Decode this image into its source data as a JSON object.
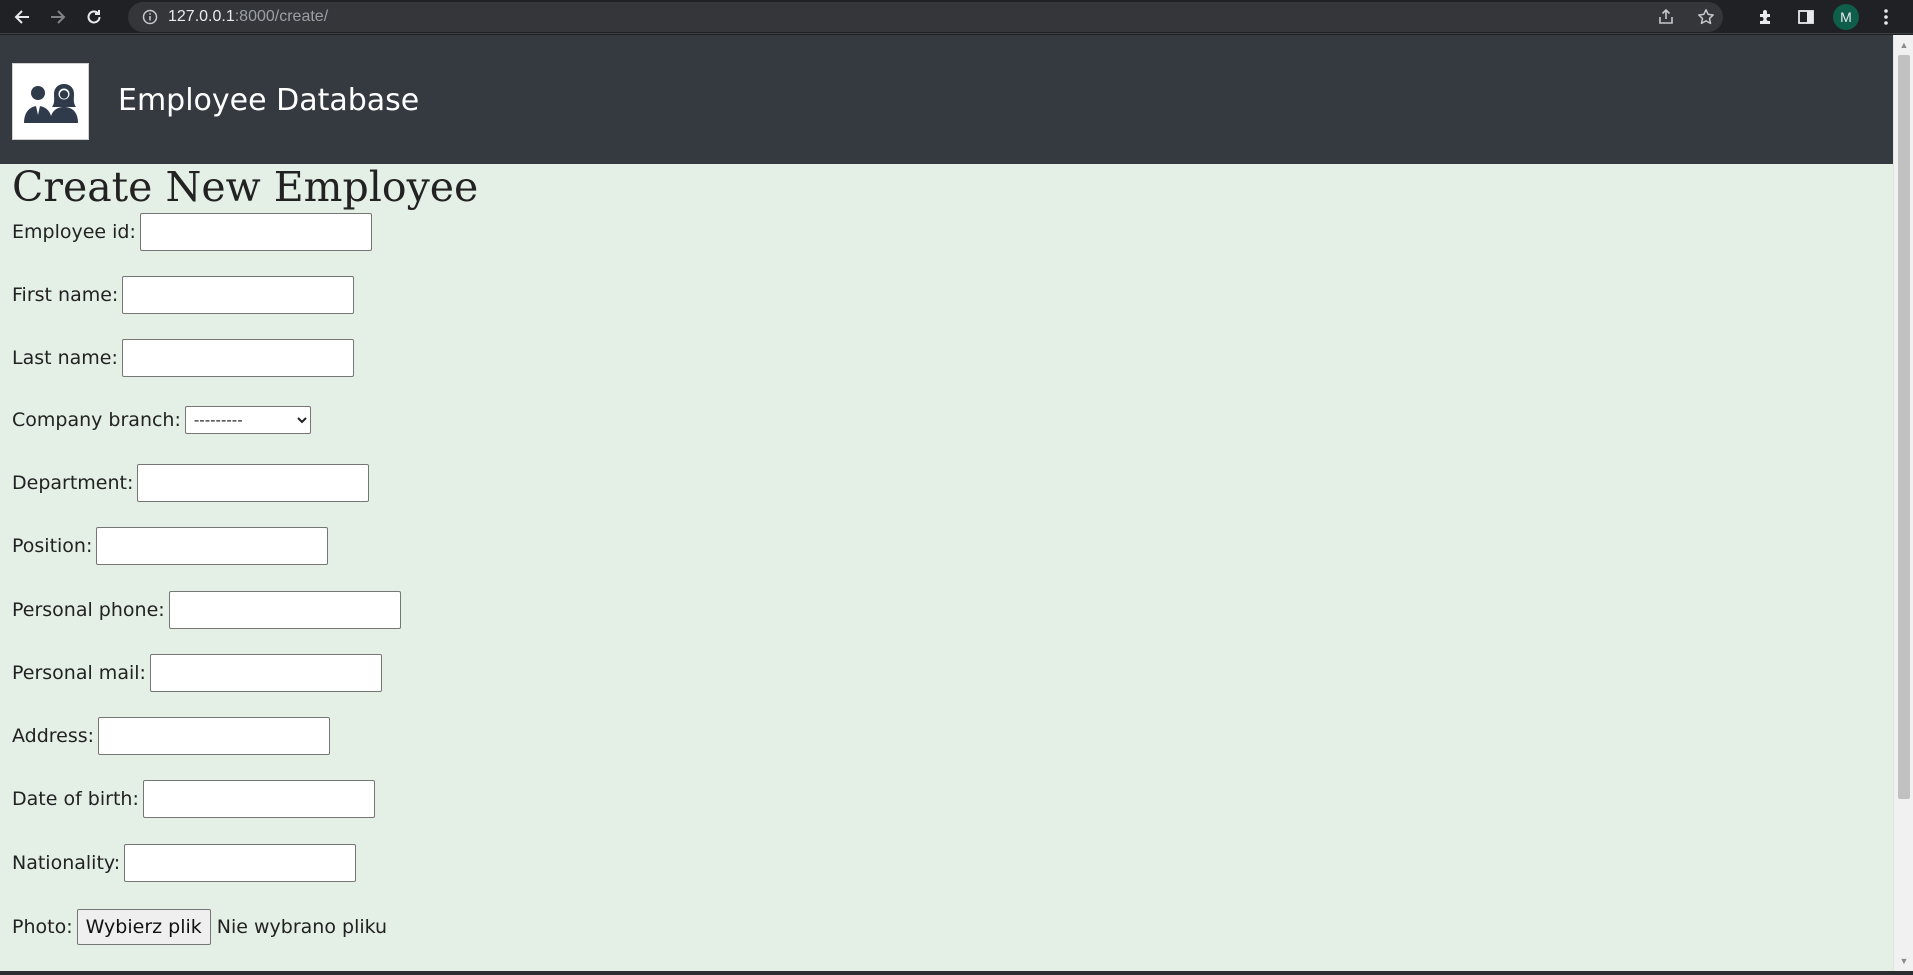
{
  "browser": {
    "url_host": "127.0.0.1",
    "url_rest": ":8000/create/",
    "profile_initial": "M"
  },
  "header": {
    "site_title": "Employee Database"
  },
  "form": {
    "title": "Create New Employee",
    "fields": {
      "employee_id": {
        "label": "Employee id:",
        "value": ""
      },
      "first_name": {
        "label": "First name:",
        "value": ""
      },
      "last_name": {
        "label": "Last name:",
        "value": ""
      },
      "company_branch": {
        "label": "Company branch:",
        "selected": "---------"
      },
      "department": {
        "label": "Department:",
        "value": ""
      },
      "position": {
        "label": "Position:",
        "value": ""
      },
      "personal_phone": {
        "label": "Personal phone:",
        "value": ""
      },
      "personal_mail": {
        "label": "Personal mail:",
        "value": ""
      },
      "address": {
        "label": "Address:",
        "value": ""
      },
      "date_of_birth": {
        "label": "Date of birth:",
        "value": ""
      },
      "nationality": {
        "label": "Nationality:",
        "value": ""
      },
      "photo": {
        "label": "Photo:",
        "button_label": "Wybierz plik",
        "status": "Nie wybrano pliku"
      }
    }
  },
  "colors": {
    "page_background": "#e4efe6",
    "header_background": "#343a40",
    "browser_chrome": "#202124",
    "avatar": "#0f5e4b"
  }
}
